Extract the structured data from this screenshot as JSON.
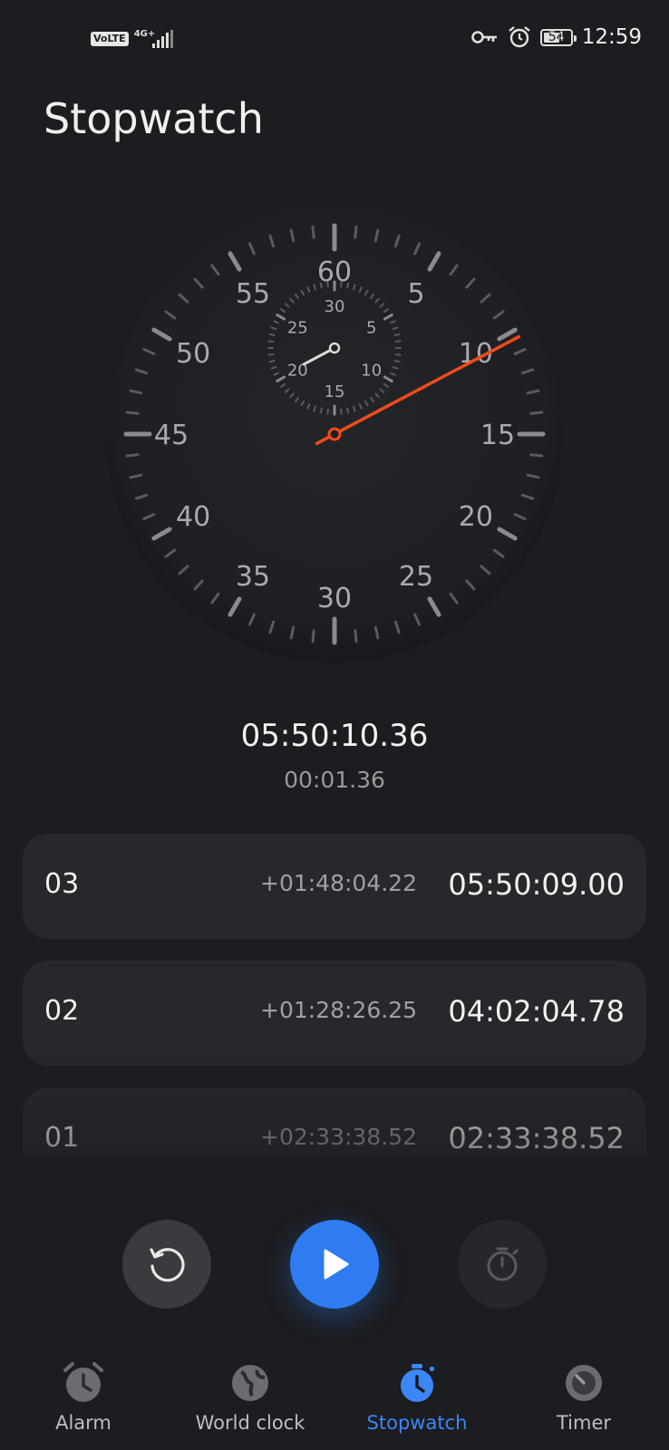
{
  "status_bar": {
    "volte": "VoLTE",
    "network": "4G+",
    "battery": "54",
    "time": "12:59"
  },
  "page": {
    "title": "Stopwatch"
  },
  "dial": {
    "outer_labels": [
      "60",
      "5",
      "10",
      "15",
      "20",
      "25",
      "30",
      "35",
      "40",
      "45",
      "50",
      "55"
    ],
    "inner_labels": [
      "30",
      "5",
      "10",
      "15",
      "20",
      "25"
    ],
    "second_hand_value_seconds": 10.36,
    "minute_hand_value_minutes": 50.17,
    "colors": {
      "second_hand": "#f04a1a",
      "minute_hand": "#d9d9d9",
      "ticks": "#5a5b5f",
      "major_ticks": "#8a8b8f",
      "labels": "#a9aaad"
    }
  },
  "readout": {
    "total": "05:50:10.36",
    "lap": "00:01.36"
  },
  "laps": [
    {
      "number": "03",
      "diff": "+01:48:04.22",
      "total": "05:50:09.00"
    },
    {
      "number": "02",
      "diff": "+01:28:26.25",
      "total": "04:02:04.78"
    },
    {
      "number": "01",
      "diff": "+02:33:38.52",
      "total": "02:33:38.52"
    }
  ],
  "controls": {
    "reset_icon": "reset-icon",
    "play_icon": "play-icon",
    "lap_icon": "stopwatch-icon",
    "colors": {
      "play": "#2f7bf2"
    }
  },
  "nav": {
    "items": [
      {
        "label": "Alarm",
        "icon": "alarm-clock-icon"
      },
      {
        "label": "World clock",
        "icon": "globe-icon"
      },
      {
        "label": "Stopwatch",
        "icon": "stopwatch-icon"
      },
      {
        "label": "Timer",
        "icon": "timer-icon"
      }
    ],
    "active": "Stopwatch",
    "active_color": "#3d86f5"
  }
}
